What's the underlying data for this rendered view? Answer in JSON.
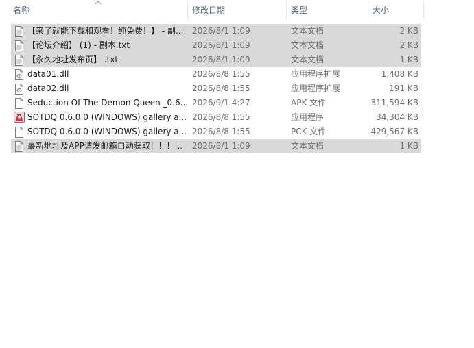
{
  "columns": {
    "name": "名称",
    "date": "修改日期",
    "type": "类型",
    "size": "大小"
  },
  "files": [
    {
      "name": "【来了就能下载和观看！纯免费！】 - 副...",
      "date": "2026/8/1 1:09",
      "type": "文本文档",
      "size": "2 KB",
      "icon": "text-document-icon",
      "selected": true
    },
    {
      "name": "【论坛介绍】 (1) - 副本.txt",
      "date": "2026/8/1 1:09",
      "type": "文本文档",
      "size": "2 KB",
      "icon": "text-document-icon",
      "selected": true
    },
    {
      "name": "【永久地址发布页】 .txt",
      "date": "2026/8/1 1:09",
      "type": "文本文档",
      "size": "1 KB",
      "icon": "text-document-icon",
      "selected": true
    },
    {
      "name": "data01.dll",
      "date": "2026/8/8 1:55",
      "type": "应用程序扩展",
      "size": "1,408 KB",
      "icon": "dll-file-icon",
      "selected": false
    },
    {
      "name": "data02.dll",
      "date": "2026/8/8 1:55",
      "type": "应用程序扩展",
      "size": "191 KB",
      "icon": "dll-file-icon",
      "selected": false
    },
    {
      "name": "Seduction Of The Demon Queen _0.6....",
      "date": "2026/9/1 4:27",
      "type": "APK 文件",
      "size": "311,594 KB",
      "icon": "blank-file-icon",
      "selected": false
    },
    {
      "name": "SOTDQ 0.6.0.0 (WINDOWS) gallery a...",
      "date": "2026/8/8 1:55",
      "type": "应用程序",
      "size": "34,304 KB",
      "icon": "application-icon",
      "selected": false
    },
    {
      "name": "SOTDQ 0.6.0.0 (WINDOWS) gallery a...",
      "date": "2026/8/8 1:55",
      "type": "PCK 文件",
      "size": "429,567 KB",
      "icon": "blank-file-icon",
      "selected": false
    },
    {
      "name": "最新地址及APP请发邮箱自动获取！！！...",
      "date": "2026/8/1 1:09",
      "type": "文本文档",
      "size": "1 KB",
      "icon": "text-document-icon",
      "selected": true
    }
  ]
}
